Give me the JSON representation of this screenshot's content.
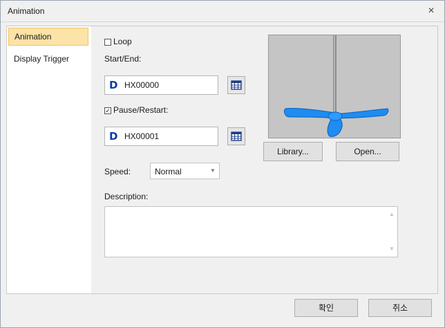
{
  "window": {
    "title": "Animation",
    "close_glyph": "×"
  },
  "sidebar": {
    "items": [
      {
        "label": "Animation",
        "selected": true
      },
      {
        "label": "Display Trigger",
        "selected": false
      }
    ]
  },
  "loop": {
    "label": "Loop",
    "checked": false
  },
  "start_end": {
    "label": "Start/End:",
    "device_prefix": "D",
    "value": "HX00000",
    "tag_icon": "tag-browse-icon"
  },
  "pause_restart": {
    "label": "Pause/Restart:",
    "checked": true,
    "device_prefix": "D",
    "value": "HX00001",
    "tag_icon": "tag-browse-icon"
  },
  "speed": {
    "label": "Speed:",
    "value": "Normal"
  },
  "preview": {
    "image": "blue-propeller-mixer"
  },
  "buttons": {
    "library": "Library...",
    "open": "Open..."
  },
  "description": {
    "label": "Description:",
    "value": ""
  },
  "footer": {
    "ok": "확인",
    "cancel": "취소"
  },
  "colors": {
    "selected_bg": "#fce3a8",
    "selected_border": "#f2c35f",
    "device_letter": "#0b3ba8",
    "propeller": "#1e8cf0"
  }
}
